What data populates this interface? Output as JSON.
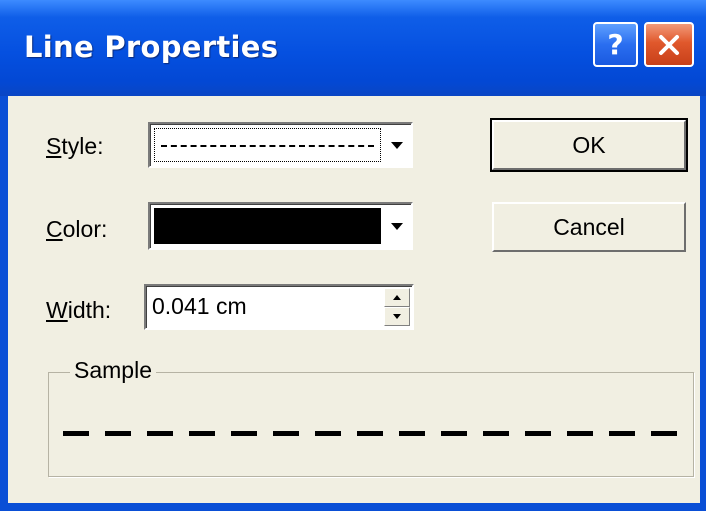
{
  "window": {
    "title": "Line Properties",
    "help_label": "?",
    "close_label": "✕"
  },
  "style": {
    "label_underline": "S",
    "label_rest": "tyle:",
    "value": "dashed"
  },
  "color": {
    "label_underline": "C",
    "label_rest": "olor:",
    "value": "#000000"
  },
  "width": {
    "label_underline": "W",
    "label_rest": "idth:",
    "value": "0.041 cm"
  },
  "buttons": {
    "ok_label": "OK",
    "cancel_label": "Cancel"
  },
  "sample": {
    "legend": "Sample"
  },
  "colors": {
    "titlebar": "#0550e0",
    "dialog_face": "#f1efe2",
    "close_button": "#e0582c"
  }
}
